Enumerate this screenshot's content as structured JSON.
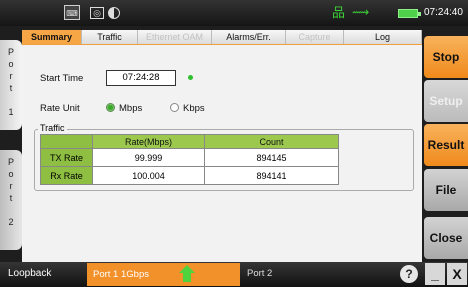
{
  "status_bar": {
    "keyboard_icon": "keyboard-icon",
    "camera_icon": "camera-icon",
    "display_icon": "brightness-icon",
    "network_icon": "network-icon",
    "usb_icon": "usb-icon",
    "battery_icon": "battery-icon",
    "time": "07:24:40"
  },
  "ports": [
    {
      "letters": [
        "P",
        "o",
        "r",
        "t",
        "",
        "1"
      ]
    },
    {
      "letters": [
        "P",
        "o",
        "r",
        "t",
        "",
        "2"
      ]
    }
  ],
  "tabs": [
    {
      "label": "Summary",
      "state": "active"
    },
    {
      "label": "Traffic",
      "state": "normal"
    },
    {
      "label": "Ethernet OAM",
      "state": "disabled"
    },
    {
      "label": "Alarms/Err.",
      "state": "normal"
    },
    {
      "label": "Capture",
      "state": "disabled"
    },
    {
      "label": "Log",
      "state": "normal"
    }
  ],
  "summary": {
    "start_time_label": "Start Time",
    "start_time_value": "07:24:28",
    "rate_unit_label": "Rate Unit",
    "rate_unit_options": [
      "Mbps",
      "Kbps"
    ],
    "rate_unit_selected": "Mbps"
  },
  "traffic": {
    "group_label": "Traffic",
    "columns": [
      "Rate(Mbps)",
      "Count"
    ],
    "rows": [
      {
        "label": "TX Rate",
        "rate": "99.999",
        "count": "894145"
      },
      {
        "label": "Rx Rate",
        "rate": "100.004",
        "count": "894141"
      }
    ]
  },
  "side_buttons": [
    "Stop",
    "Setup",
    "Result",
    "File",
    "Close"
  ],
  "bottom_bar": {
    "loopback": "Loopback",
    "port1_status": "Port 1  1Gbps",
    "port2_status": "Port 2",
    "help": "?",
    "minimize": "_",
    "close": "X"
  },
  "colors": {
    "accent": "#f7a646",
    "table_header": "#9bc84d",
    "link_up": "#4ed23e"
  }
}
